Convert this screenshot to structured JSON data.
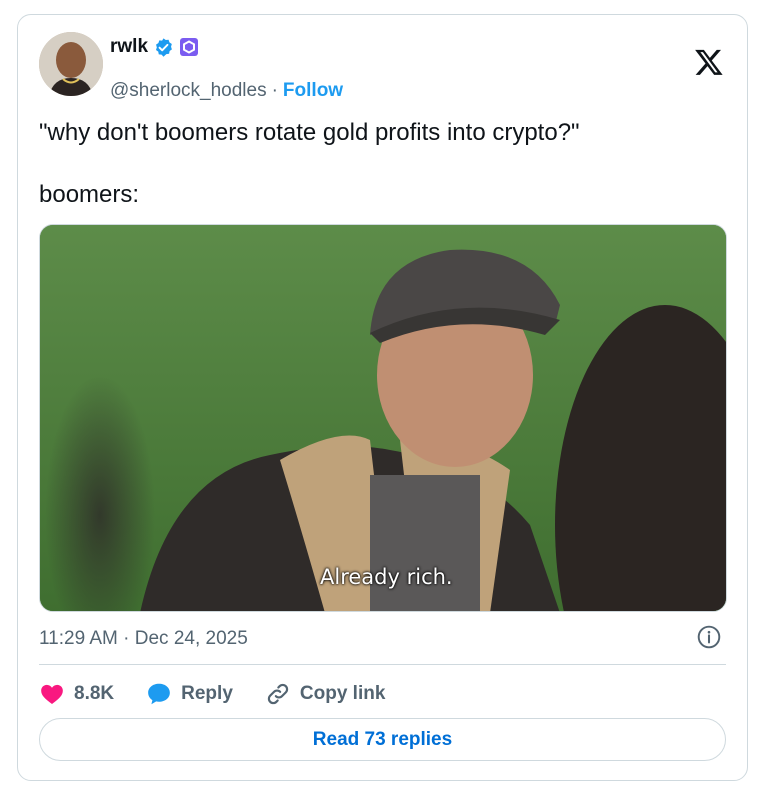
{
  "author": {
    "display_name": "rwlk",
    "handle": "@sherlock_hodles",
    "separator": "·",
    "follow_label": "Follow"
  },
  "tweet": {
    "line1": "\"why don't boomers rotate gold profits into crypto?\"",
    "line2": "boomers:",
    "media_caption": "Already rich.",
    "time": "11:29 AM",
    "date_separator": "·",
    "date": "Dec 24, 2025"
  },
  "actions": {
    "like_count": "8.8K",
    "reply_label": "Reply",
    "copy_link_label": "Copy link"
  },
  "read_replies_label": "Read 73 replies",
  "colors": {
    "accent": "#1d9bf0",
    "like": "#f91880",
    "text_secondary": "#536471"
  },
  "icons": [
    "verified-badge-icon",
    "affiliate-badge-icon",
    "x-logo-icon",
    "info-icon",
    "heart-icon",
    "reply-bubble-icon",
    "link-icon"
  ]
}
